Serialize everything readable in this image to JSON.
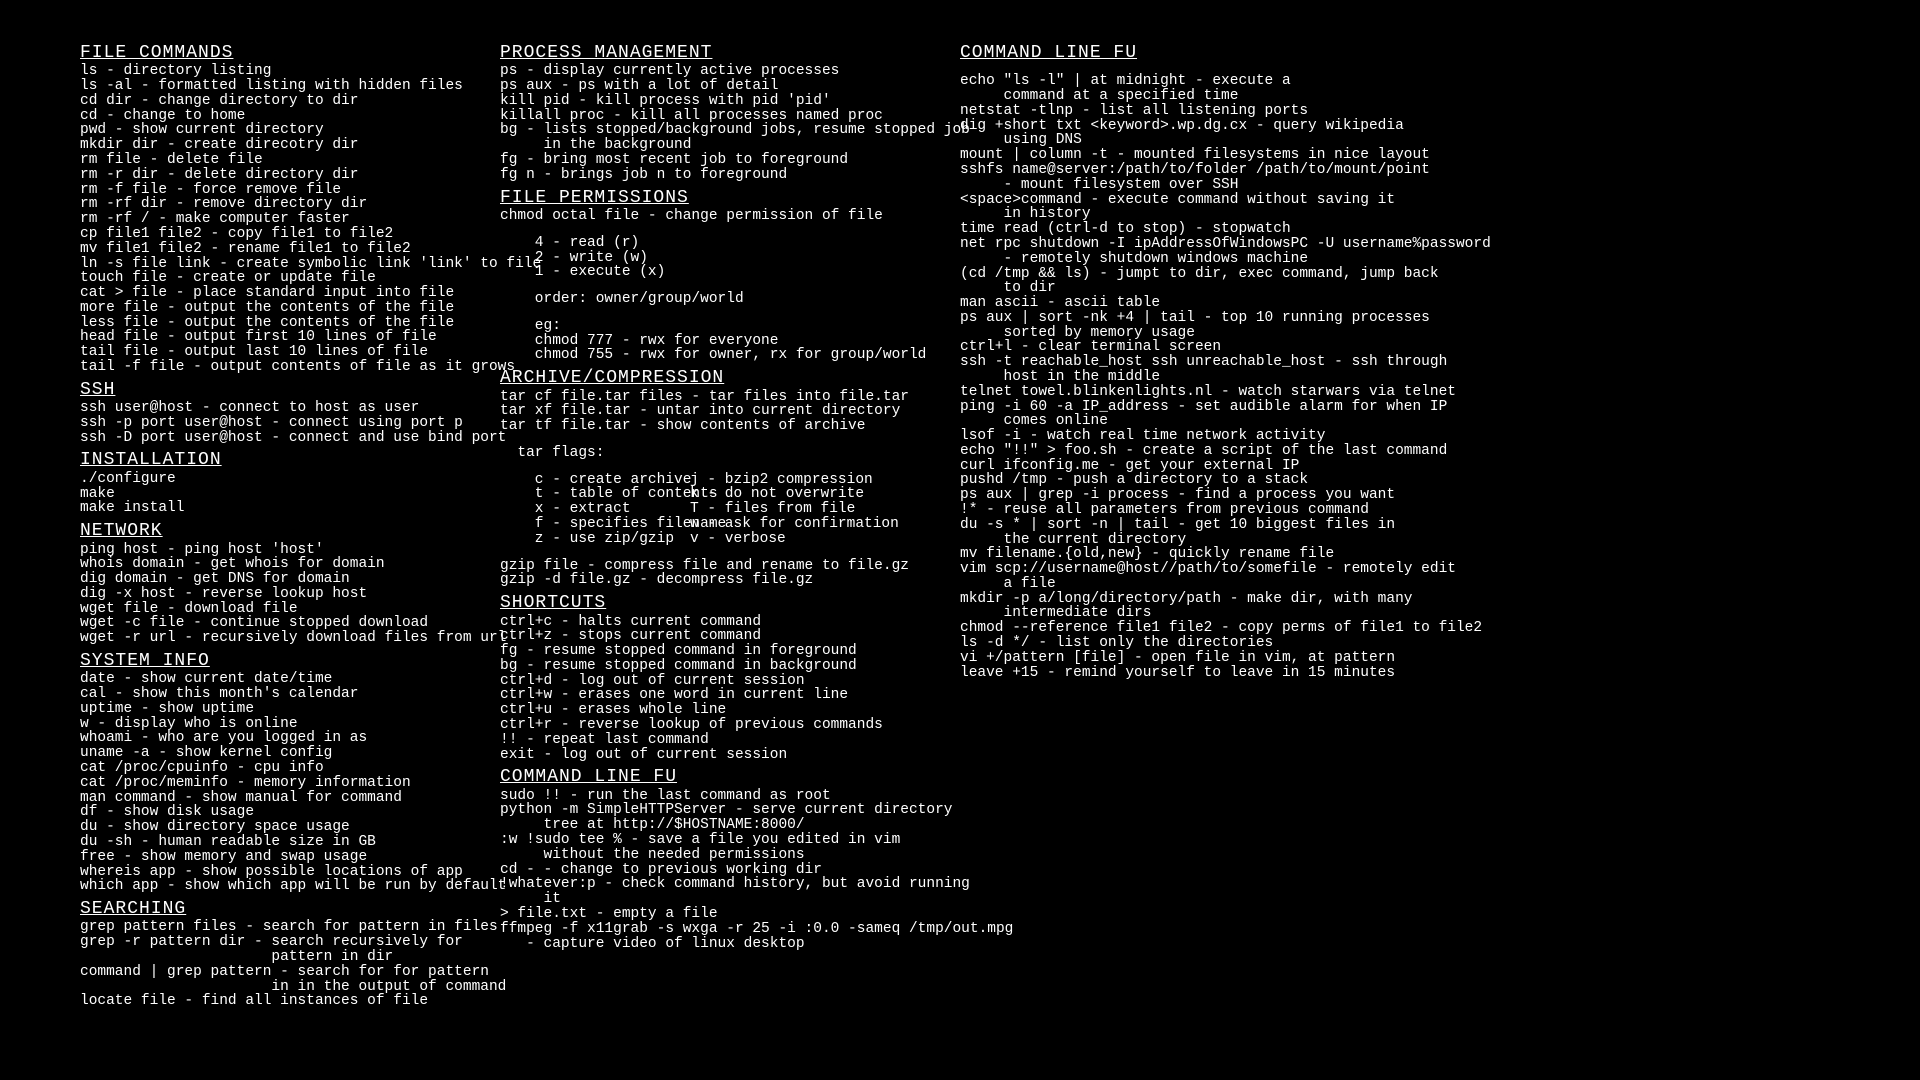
{
  "col1": {
    "file_commands": {
      "title": "FILE COMMANDS",
      "lines": [
        "ls - directory listing",
        "ls -al - formatted listing with hidden files",
        "cd dir - change directory to dir",
        "cd - change to home",
        "pwd - show current directory",
        "mkdir dir - create direcotry dir",
        "rm file - delete file",
        "rm -r dir - delete directory dir",
        "rm -f file - force remove file",
        "rm -rf dir - remove directory dir",
        "rm -rf / - make computer faster",
        "cp file1 file2 - copy file1 to file2",
        "mv file1 file2 - rename file1 to file2",
        "ln -s file link - create symbolic link 'link' to file",
        "touch file - create or update file",
        "cat > file - place standard input into file",
        "more file - output the contents of the file",
        "less file - output the contents of the file",
        "head file - output first 10 lines of file",
        "tail file - output last 10 lines of file",
        "tail -f file - output contents of file as it grows"
      ]
    },
    "ssh": {
      "title": "SSH",
      "lines": [
        "ssh user@host - connect to host as user",
        "ssh -p port user@host - connect using port p",
        "ssh -D port user@host - connect and use bind port"
      ]
    },
    "installation": {
      "title": "INSTALLATION",
      "lines": [
        "./configure",
        "make",
        "make install"
      ]
    },
    "network": {
      "title": "NETWORK",
      "lines": [
        "ping host - ping host 'host'",
        "whois domain - get whois for domain",
        "dig domain - get DNS for domain",
        "dig -x host - reverse lookup host",
        "wget file - download file",
        "wget -c file - continue stopped download",
        "wget -r url - recursively download files from url"
      ]
    },
    "system_info": {
      "title": "SYSTEM INFO",
      "lines": [
        "date - show current date/time",
        "cal - show this month's calendar",
        "uptime - show uptime",
        "w - display who is online",
        "whoami - who are you logged in as",
        "uname -a - show kernel config",
        "cat /proc/cpuinfo - cpu info",
        "cat /proc/meminfo - memory information",
        "man command - show manual for command",
        "df - show disk usage",
        "du - show directory space usage",
        "du -sh - human readable size in GB",
        "free - show memory and swap usage",
        "whereis app - show possible locations of app",
        "which app - show which app will be run by default"
      ]
    },
    "searching": {
      "title": "SEARCHING",
      "lines": [
        "grep pattern files - search for pattern in files",
        "grep -r pattern dir - search recursively for\n                      pattern in dir",
        "command | grep pattern - search for for pattern\n                      in in the output of command",
        "locate file - find all instances of file"
      ]
    }
  },
  "col2": {
    "process": {
      "title": "PROCESS MANAGEMENT",
      "lines": [
        "ps - display currently active processes",
        "ps aux - ps with a lot of detail",
        "kill pid - kill process with pid 'pid'",
        "killall proc - kill all processes named proc",
        "bg - lists stopped/background jobs, resume stopped job\n     in the background",
        "fg - bring most recent job to foreground",
        "fg n - brings job n to foreground"
      ]
    },
    "permissions": {
      "title": "FILE PERMISSIONS",
      "line1": "chmod octal file - change permission of file",
      "bits": "    4 - read (r)\n    2 - write (w)\n    1 - execute (x)",
      "order": "    order: owner/group/world",
      "eg": "    eg:\n    chmod 777 - rwx for everyone\n    chmod 755 - rwx for owner, rx for group/world"
    },
    "archive": {
      "title": "ARCHIVE/COMPRESSION",
      "lines": [
        "tar cf file.tar files - tar files into file.tar",
        "tar xf file.tar - untar into current directory",
        "tar tf file.tar - show contents of archive"
      ],
      "flags_label": "  tar flags:",
      "flagsA": "    c - create archive\n    t - table of contents\n    x - extract\n    f - specifies filename\n    z - use zip/gzip",
      "flagsB": "j - bzip2 compression\nk - do not overwrite\nT - files from file\nw - ask for confirmation\nv - verbose",
      "gzip": [
        "gzip file - compress file and rename to file.gz",
        "gzip -d file.gz - decompress file.gz"
      ]
    },
    "shortcuts": {
      "title": "SHORTCUTS",
      "lines": [
        "ctrl+c - halts current command",
        "ctrl+z - stops current command",
        "fg - resume stopped command in foreground",
        "bg - resume stopped command in background",
        "ctrl+d - log out of current session",
        "ctrl+w - erases one word in current line",
        "ctrl+u - erases whole line",
        "ctrl+r - reverse lookup of previous commands",
        "!! - repeat last command",
        "exit - log out of current session"
      ]
    },
    "fu": {
      "title": "COMMAND LINE FU",
      "lines": [
        "sudo !! - run the last command as root",
        "python -m SimpleHTTPServer - serve current directory\n     tree at http://$HOSTNAME:8000/",
        ":w !sudo tee % - save a file you edited in vim\n     without the needed permissions",
        "cd - - change to previous working dir",
        "!whatever:p - check command history, but avoid running\n     it",
        "> file.txt - empty a file",
        "ffmpeg -f x11grab -s wxga -r 25 -i :0.0 -sameq /tmp/out.mpg\n   - capture video of linux desktop"
      ]
    }
  },
  "col3": {
    "fu": {
      "title": "COMMAND LINE FU",
      "lines": [
        "echo \"ls -l\" | at midnight - execute a\n     command at a specified time",
        "netstat -tlnp - list all listening ports",
        "dig +short txt <keyword>.wp.dg.cx - query wikipedia\n     using DNS",
        "mount | column -t - mounted filesystems in nice layout",
        "sshfs name@server:/path/to/folder /path/to/mount/point\n     - mount filesystem over SSH",
        "<space>command - execute command without saving it\n     in history",
        "time read (ctrl-d to stop) - stopwatch",
        "net rpc shutdown -I ipAddressOfWindowsPC -U username%password\n     - remotely shutdown windows machine",
        "(cd /tmp && ls) - jumpt to dir, exec command, jump back\n     to dir",
        "man ascii - ascii table",
        "ps aux | sort -nk +4 | tail - top 10 running processes\n     sorted by memory usage",
        "ctrl+l - clear terminal screen",
        "ssh -t reachable_host ssh unreachable_host - ssh through\n     host in the middle",
        "telnet towel.blinkenlights.nl - watch starwars via telnet",
        "ping -i 60 -a IP_address - set audible alarm for when IP\n     comes online",
        "lsof -i - watch real time network activity",
        "echo \"!!\" > foo.sh - create a script of the last command",
        "curl ifconfig.me - get your external IP",
        "pushd /tmp - push a directory to a stack",
        "ps aux | grep -i process - find a process you want",
        "!* - reuse all parameters from previous command",
        "du -s * | sort -n | tail - get 10 biggest files in\n     the current directory",
        "mv filename.{old,new} - quickly rename file",
        "vim scp://username@host//path/to/somefile - remotely edit\n     a file",
        "mkdir -p a/long/directory/path - make dir, with many\n     intermediate dirs",
        "chmod --reference file1 file2 - copy perms of file1 to file2",
        "ls -d */ - list only the directories",
        "vi +/pattern [file] - open file in vim, at pattern",
        "leave +15 - remind yourself to leave in 15 minutes"
      ]
    }
  }
}
